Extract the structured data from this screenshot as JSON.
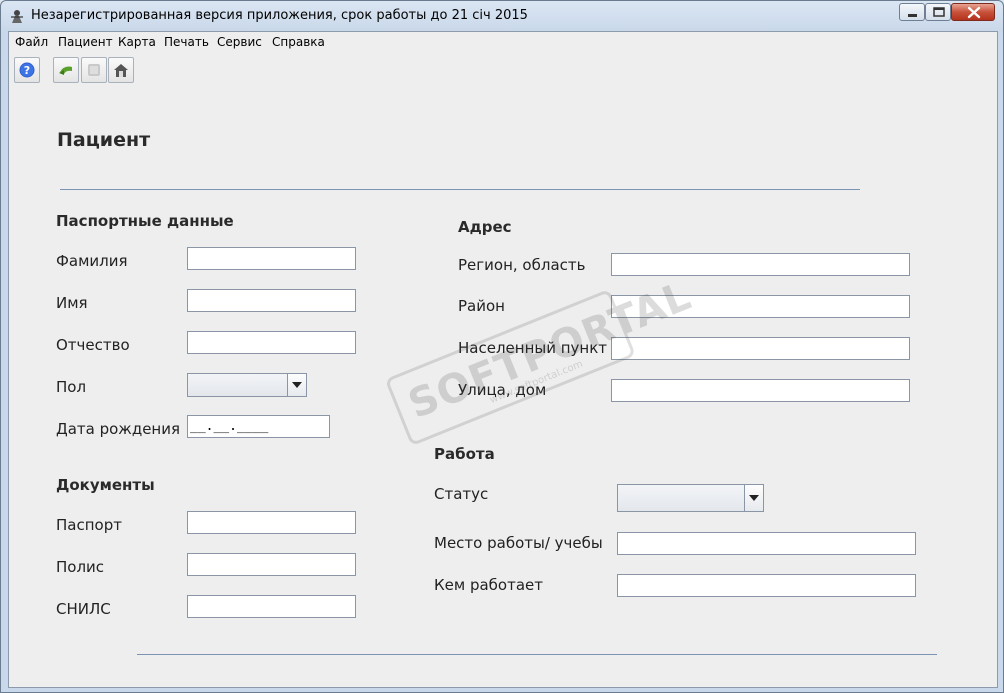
{
  "window": {
    "title": "Незарегистрированная версия приложения, срок работы до 21 січ 2015"
  },
  "menu": [
    "Файл",
    "Пациент",
    "Карта",
    "Печать",
    "Сервис",
    "Справка"
  ],
  "toolbar": {
    "icons": [
      "help-icon",
      "back-icon",
      "disabled-icon",
      "home-icon"
    ]
  },
  "page": {
    "title": "Пациент"
  },
  "passport": {
    "heading": "Паспортные данные",
    "last_name_label": "Фамилия",
    "last_name_value": "",
    "first_name_label": "Имя",
    "first_name_value": "",
    "patronymic_label": "Отчество",
    "patronymic_value": "",
    "gender_label": "Пол",
    "gender_value": "",
    "birth_date_label": "Дата рождения",
    "birth_date_value": "__.__.____"
  },
  "documents": {
    "heading": "Документы",
    "passport_label": "Паспорт",
    "passport_value": "",
    "policy_label": "Полис",
    "policy_value": "",
    "snils_label": "СНИЛС",
    "snils_value": ""
  },
  "address": {
    "heading": "Адрес",
    "region_label": "Регион, область",
    "region_value": "",
    "district_label": "Район",
    "district_value": "",
    "locality_label": "Населенный пункт",
    "locality_value": "",
    "street_label": "Улица, дом",
    "street_value": ""
  },
  "work": {
    "heading": "Работа",
    "status_label": "Статус",
    "status_value": "",
    "workplace_label": "Место работы/ учебы",
    "workplace_value": "",
    "position_label": "Кем работает",
    "position_value": ""
  },
  "watermark": {
    "text": "SOFTPORTAL",
    "sub": "www.softportal.com"
  },
  "colors": {
    "background": "#eeeeee",
    "rule": "#7c93b3",
    "close_button": "#c8523b"
  }
}
